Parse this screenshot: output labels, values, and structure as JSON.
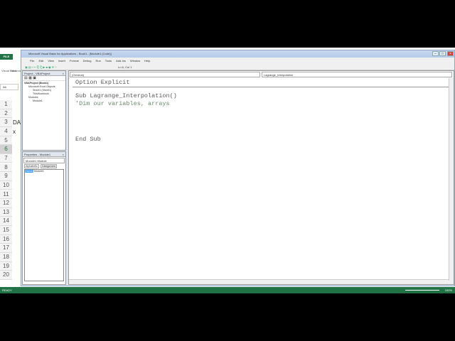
{
  "excel": {
    "file_tab": "FILE",
    "ribbon": [
      "Visual Basic",
      "Macros"
    ],
    "name_box": "A6",
    "rows": [
      "1",
      "2",
      "3",
      "4",
      "5",
      "6",
      "7",
      "8",
      "9",
      "10",
      "11",
      "12",
      "13",
      "14",
      "15",
      "16",
      "17",
      "18",
      "19",
      "20"
    ],
    "selected_row": "6",
    "cells": {
      "a3": "DA",
      "a4": "x"
    },
    "status": "READY",
    "zoom": "100%"
  },
  "vbe": {
    "title": "Microsoft Visual Basic for Applications - Book1 - [Module1 (Code)]",
    "menu": [
      "File",
      "Edit",
      "View",
      "Insert",
      "Format",
      "Debug",
      "Run",
      "Tools",
      "Add-Ins",
      "Window",
      "Help"
    ],
    "position": "Ln 6, Col 1",
    "project": {
      "title": "Project - VBAProject",
      "items": [
        "VBAProject (Book1)",
        "Microsoft Excel Objects",
        "Sheet1 (Sheet1)",
        "ThisWorkbook",
        "Modules",
        "Module1"
      ]
    },
    "properties": {
      "title": "Properties - Module1",
      "object": "Module1 Module",
      "tabs": [
        "Alphabetic",
        "Categorized"
      ],
      "prop_name": "(Name)",
      "prop_value": "Module1"
    },
    "code": {
      "object_dropdown": "(General)",
      "proc_dropdown": "Lagrange_Interpolation",
      "lines": [
        "Option Explicit",
        "Sub Lagrange_Interpolation()",
        "'Dim our variables, arrays",
        "End Sub"
      ]
    }
  }
}
